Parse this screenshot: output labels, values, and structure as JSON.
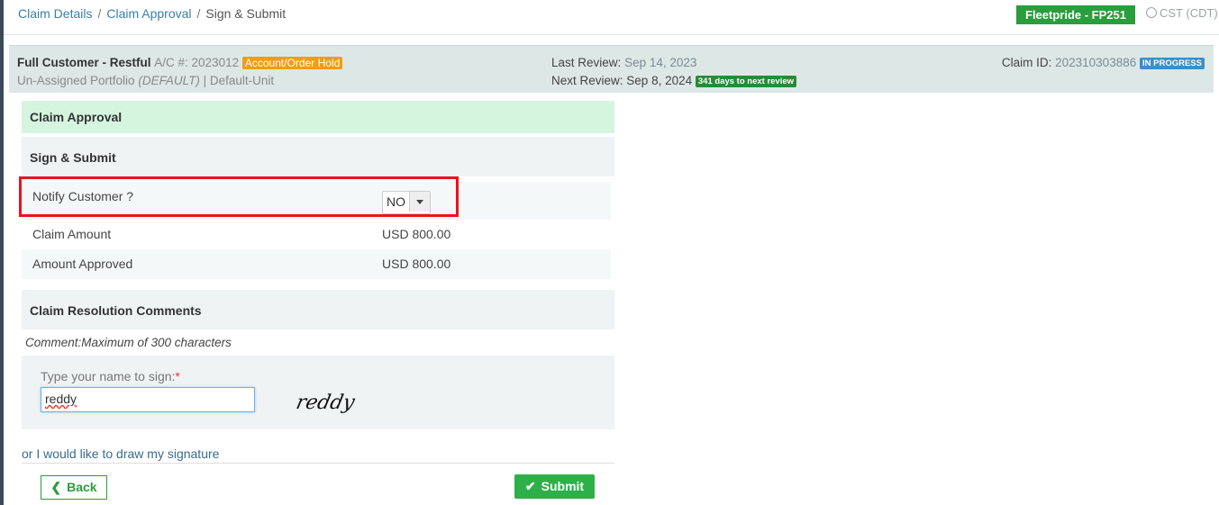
{
  "breadcrumb": [
    "Claim Details",
    "Claim Approval",
    "Sign & Submit"
  ],
  "header": {
    "org": "Fleetpride - FP251",
    "timezone": "CST (CDT)"
  },
  "customer": {
    "name": "Full Customer - Restful",
    "account_label": "A/C #: 2023012",
    "hold_badge": "Account/Order Hold",
    "portfolio": "Un-Assigned Portfolio",
    "portfolio_tag": "(DEFAULT)",
    "unit": "Default-Unit",
    "last_review_label": "Last Review:",
    "last_review": "Sep 14, 2023",
    "next_review_label": "Next Review:",
    "next_review": "Sep 8, 2024",
    "days_badge": "341 days to next review",
    "claim_id_label": "Claim ID:",
    "claim_id": "202310303886",
    "status_badge": "IN PROGRESS"
  },
  "sections": {
    "approval": "Claim Approval",
    "sign": "Sign & Submit",
    "comments": "Claim Resolution Comments"
  },
  "fields": {
    "notify_label": "Notify Customer ?",
    "notify_value": "NO",
    "claim_amount_label": "Claim Amount",
    "claim_amount": "USD 800.00",
    "approved_label": "Amount Approved",
    "approved": "USD 800.00"
  },
  "comment_hint": "Comment:Maximum of 300 characters",
  "signature": {
    "label": "Type your name to sign:",
    "required": "*",
    "value": "reddy",
    "preview": "reddy",
    "draw_link": "or I would like to draw my signature"
  },
  "buttons": {
    "back": "Back",
    "submit": "Submit"
  },
  "colors": {
    "green": "#2a9d3c",
    "highlight": "#e8141c",
    "hold": "#f39c12",
    "status": "#3a8fc7"
  }
}
